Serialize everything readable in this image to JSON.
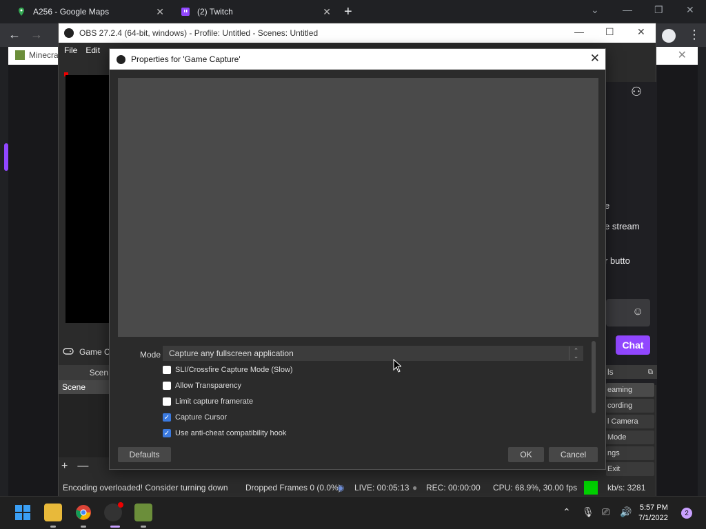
{
  "browser": {
    "tabs": [
      {
        "label": "A256 - Google Maps"
      },
      {
        "label": "(2) Twitch"
      }
    ],
    "bookmark": "Minecra"
  },
  "obs": {
    "title": "OBS 27.2.4 (64-bit, windows) - Profile: Untitled - Scenes: Untitled",
    "menu": [
      "File",
      "Edit"
    ],
    "source_label": "Game Ca",
    "scenes_header": "Scen",
    "scene_item": "Scene",
    "twitch_text": [
      "e",
      "e stream",
      "r butto"
    ],
    "chat_button": "Chat",
    "controls_header": "ls",
    "controls": [
      "eaming",
      "cording",
      "l Camera",
      "Mode",
      "ngs",
      "Exit"
    ],
    "status": {
      "message": "Encoding overloaded! Consider turning down",
      "dropped": "Dropped Frames 0 (0.0%)",
      "live": "LIVE: 00:05:13",
      "rec": "REC: 00:00:00",
      "cpu": "CPU: 68.9%, 30.00 fps",
      "kbs": "kb/s: 3281"
    }
  },
  "dialog": {
    "title": "Properties for 'Game Capture'",
    "mode_label": "Mode",
    "mode_value": "Capture any fullscreen application",
    "options": [
      {
        "label": "SLI/Crossfire Capture Mode (Slow)",
        "checked": false
      },
      {
        "label": "Allow Transparency",
        "checked": false
      },
      {
        "label": "Limit capture framerate",
        "checked": false
      },
      {
        "label": "Capture Cursor",
        "checked": true
      },
      {
        "label": "Use anti-cheat compatibility hook",
        "checked": true
      }
    ],
    "defaults_button": "Defaults",
    "ok_button": "OK",
    "cancel_button": "Cancel"
  },
  "taskbar": {
    "time": "5:57 PM",
    "date": "7/1/2022",
    "notifications": "2"
  },
  "colors": {
    "twitch_purple": "#9147ff",
    "checkbox_on": "#3b7ae0",
    "status_green": "#00d000"
  }
}
